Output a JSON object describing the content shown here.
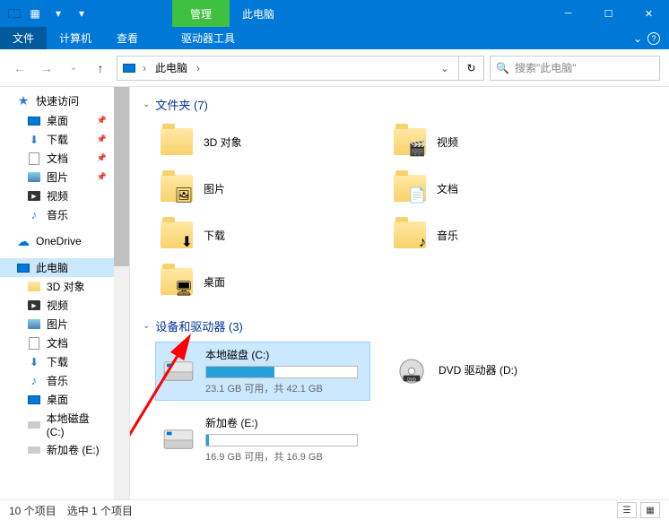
{
  "titlebar": {
    "manage_label": "管理",
    "title": "此电脑"
  },
  "ribbon": {
    "file": "文件",
    "computer": "计算机",
    "view": "查看",
    "drive_tools": "驱动器工具"
  },
  "addressbar": {
    "crumb_root": "此电脑",
    "search_placeholder": "搜索\"此电脑\""
  },
  "sidebar": {
    "quick_access": "快速访问",
    "qa_items": [
      {
        "label": "桌面",
        "icon": "desktop",
        "pinned": true
      },
      {
        "label": "下载",
        "icon": "download",
        "pinned": true
      },
      {
        "label": "文档",
        "icon": "doc",
        "pinned": true
      },
      {
        "label": "图片",
        "icon": "pic",
        "pinned": true
      },
      {
        "label": "视频",
        "icon": "vid",
        "pinned": false
      },
      {
        "label": "音乐",
        "icon": "music",
        "pinned": false
      }
    ],
    "onedrive": "OneDrive",
    "this_pc": "此电脑",
    "pc_items": [
      {
        "label": "3D 对象",
        "icon": "folder"
      },
      {
        "label": "视频",
        "icon": "vid"
      },
      {
        "label": "图片",
        "icon": "pic"
      },
      {
        "label": "文档",
        "icon": "doc"
      },
      {
        "label": "下载",
        "icon": "download"
      },
      {
        "label": "音乐",
        "icon": "music"
      },
      {
        "label": "桌面",
        "icon": "desktop"
      },
      {
        "label": "本地磁盘 (C:)",
        "icon": "drive"
      },
      {
        "label": "新加卷 (E:)",
        "icon": "drive"
      }
    ]
  },
  "content": {
    "folders_head": "文件夹 (7)",
    "folders": [
      {
        "label": "3D 对象",
        "overlay": ""
      },
      {
        "label": "视频",
        "overlay": "🎬"
      },
      {
        "label": "图片",
        "overlay": "🖼"
      },
      {
        "label": "文档",
        "overlay": "📄"
      },
      {
        "label": "下载",
        "overlay": "⬇"
      },
      {
        "label": "音乐",
        "overlay": "♪"
      },
      {
        "label": "桌面",
        "overlay": "🖥"
      }
    ],
    "drives_head": "设备和驱动器 (3)",
    "drives": [
      {
        "name": "本地磁盘 (C:)",
        "text": "23.1 GB 可用，共 42.1 GB",
        "fill_pct": 45,
        "selected": true,
        "type": "hdd",
        "full": false
      },
      {
        "name": "DVD 驱动器 (D:)",
        "text": "",
        "fill_pct": 0,
        "selected": false,
        "type": "dvd",
        "full": false
      },
      {
        "name": "新加卷 (E:)",
        "text": "16.9 GB 可用，共 16.9 GB",
        "fill_pct": 2,
        "selected": false,
        "type": "hdd",
        "full": false
      }
    ]
  },
  "statusbar": {
    "count": "10 个项目",
    "selected": "选中 1 个项目"
  }
}
